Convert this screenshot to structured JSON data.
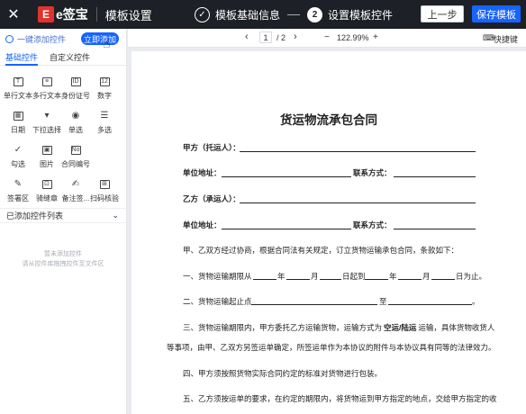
{
  "header": {
    "close": "✕",
    "logo_mark": "E",
    "logo_text": "e签宝",
    "title": "模板设置",
    "step1_icon": "✓",
    "step1_label": "模板基础信息",
    "step2_num": "2",
    "step2_label": "设置模板控件",
    "prev_label": "上一步",
    "save_label": "保存模板"
  },
  "sidebar": {
    "quick_label": "一键添加控件",
    "quick_add_label": "立即添加",
    "tabs": [
      "基础控件",
      "自定义控件"
    ],
    "controls": [
      {
        "label": "单行文本",
        "icon": "T"
      },
      {
        "label": "多行文本",
        "icon": "≡"
      },
      {
        "label": "身份证号",
        "icon": "ID"
      },
      {
        "label": "数字",
        "icon": "12"
      },
      {
        "label": "日期",
        "icon": "▦"
      },
      {
        "label": "下拉选择",
        "icon": "▾"
      },
      {
        "label": "单选",
        "icon": "◉"
      },
      {
        "label": "多选",
        "icon": "☰"
      },
      {
        "label": "勾选",
        "icon": "✓"
      },
      {
        "label": "图片",
        "icon": "▣"
      },
      {
        "label": "合同编号",
        "icon": "No"
      },
      {
        "label": "",
        "icon": ""
      },
      {
        "label": "签署区",
        "icon": "✎"
      },
      {
        "label": "骑缝章",
        "icon": "⊡"
      },
      {
        "label": "备注签...",
        "icon": "✍"
      },
      {
        "label": "扫码核验",
        "icon": "⊞"
      }
    ],
    "added_section": "已添加控件列表",
    "empty_line1": "暂未添加控件",
    "empty_line2": "请从控件库拖拽控件至文件区"
  },
  "toolbar": {
    "prev_page": "‹",
    "page_current": "1",
    "page_total": "/ 2",
    "next_page": "›",
    "zoom_out": "−",
    "zoom": "122.99%",
    "zoom_in": "+",
    "shortcut": "快捷键"
  },
  "document": {
    "title": "货运物流承包合同",
    "party_a": "甲方（托运人）：",
    "unit_addr": "单位地址：",
    "contact": "联系方式：",
    "party_b": "乙方（承运人）：",
    "p1": "甲、乙双方经过协商，根据合同法有关规定，订立货物运输承包合同，条款如下：",
    "p2_a": "一、货物运输期限从",
    "p2_y1": "年",
    "p2_m1": "月",
    "p2_d1": "日起到",
    "p2_y2": "年",
    "p2_m2": "月",
    "p2_d2": "日为止。",
    "p3_a": "二、货物运输起止点",
    "p3_b": "至",
    "p3_end": "。",
    "p4_a": "三、货物运输期限内，甲方委托乙方运输货物，运输方式为",
    "p4_bold": "空运/陆运",
    "p4_b": "运输，具体货物收货人",
    "p4_line2": "等事项，由甲、乙双方另签运单确定，所签运单作为本协议的附件与本协议具有同等的法律效力。",
    "p5": "四、甲方须按照货物实际合同约定的标准对货物进行包装。",
    "p6": "五、乙方须按运单的要求，在约定的期限内，将货物运到甲方指定的地点，交给甲方指定的收"
  }
}
